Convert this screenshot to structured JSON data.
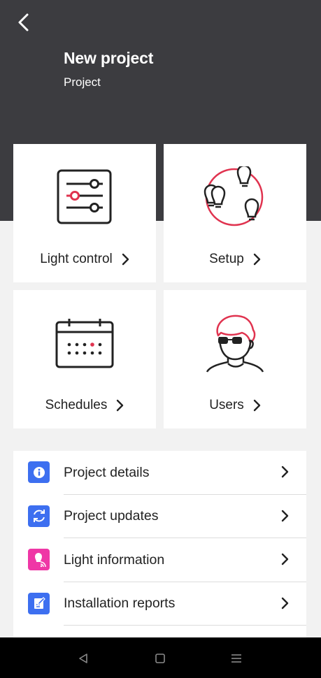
{
  "header": {
    "title": "New project",
    "subtitle": "Project",
    "background_color": "#3c3c40"
  },
  "cards": [
    {
      "label": "Light control",
      "icon": "sliders-icon"
    },
    {
      "label": "Setup",
      "icon": "bulbs-setup-icon"
    },
    {
      "label": "Schedules",
      "icon": "calendar-icon"
    },
    {
      "label": "Users",
      "icon": "user-avatar-icon"
    }
  ],
  "list": [
    {
      "label": "Project details",
      "icon": "info-icon",
      "icon_color": "#3d6ff0"
    },
    {
      "label": "Project updates",
      "icon": "refresh-icon",
      "icon_color": "#3d6ff0"
    },
    {
      "label": "Light information",
      "icon": "bulb-signal-icon",
      "icon_color": "#ef37a6"
    },
    {
      "label": "Installation reports",
      "icon": "report-edit-icon",
      "icon_color": "#3d6ff0"
    }
  ],
  "accent_color": "#e0334f",
  "navbar": {
    "back": "nav-back-icon",
    "home": "nav-home-icon",
    "recents": "nav-recents-icon"
  }
}
